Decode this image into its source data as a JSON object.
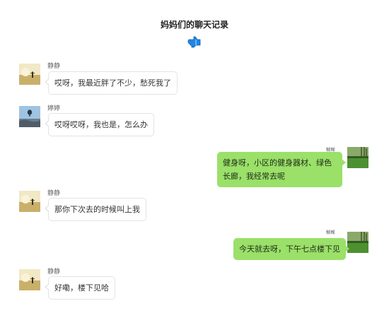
{
  "header": {
    "title": "妈妈们的聊天记录",
    "icon": "pointing-hand-icon",
    "icon_color": "#1e88e5"
  },
  "colors": {
    "incoming_bubble": "#ffffff",
    "outgoing_bubble": "#9ae069"
  },
  "messages": [
    {
      "sender": "静静",
      "direction": "incoming",
      "avatar": "sunset-field-avatar",
      "text": "哎呀，我最近胖了不少，愁死我了"
    },
    {
      "sender": "婷婷",
      "direction": "incoming",
      "avatar": "hot-air-balloon-avatar",
      "text": "哎呀哎呀，我也是，怎么办"
    },
    {
      "sender": "糊糊",
      "direction": "outgoing",
      "avatar": "green-lawn-avatar",
      "text": "健身呀，小区的健身器材、绿色长廊，我经常去呢"
    },
    {
      "sender": "静静",
      "direction": "incoming",
      "avatar": "sunset-field-avatar",
      "text": "那你下次去的时候叫上我"
    },
    {
      "sender": "糊糊",
      "direction": "outgoing",
      "avatar": "green-lawn-avatar",
      "text": "今天就去呀，下午七点楼下见"
    },
    {
      "sender": "静静",
      "direction": "incoming",
      "avatar": "sunset-field-avatar",
      "text": "好嘞，楼下见哈"
    }
  ]
}
